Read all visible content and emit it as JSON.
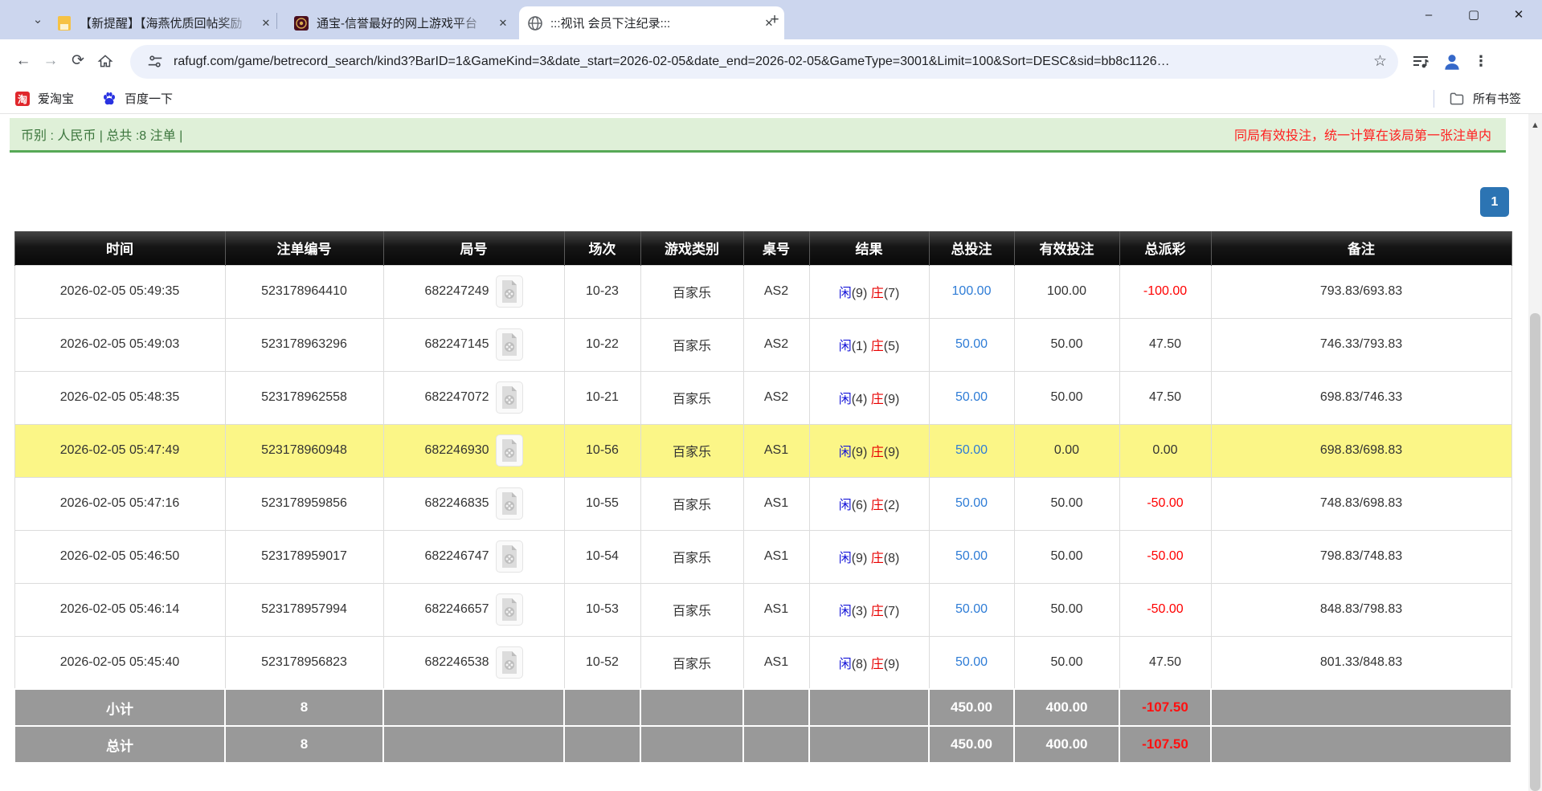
{
  "browser": {
    "tabs": [
      {
        "title": "【新提醒】【海燕优质回帖奖励",
        "favicon": "yellow-page-icon",
        "active": false
      },
      {
        "title": "通宝-信誉最好的网上游戏平台",
        "favicon": "tongbao-coin-icon",
        "active": false
      },
      {
        "title": ":::视讯 会员下注纪录:::",
        "favicon": "globe-icon",
        "active": true
      }
    ],
    "new_tab_label": "+",
    "window_controls": {
      "minimize": "–",
      "maximize": "▢",
      "close": "✕"
    },
    "url": "rafugf.com/game/betrecord_search/kind3?BarID=1&GameKind=3&date_start=2026-02-05&date_end=2026-02-05&GameType=3001&Limit=100&Sort=DESC&sid=bb8c1126…",
    "bookmarks": {
      "item1": "爱淘宝",
      "item2": "百度一下",
      "all_bookmarks": "所有书签"
    }
  },
  "page": {
    "info_bar": {
      "left": "币别 : 人民币 | 总共 :8 注单 |",
      "right": "同局有效投注，统一计算在该局第一张注单内"
    },
    "pagination": {
      "current": "1"
    },
    "table": {
      "headers": [
        "时间",
        "注单编号",
        "局号",
        "场次",
        "游戏类别",
        "桌号",
        "结果",
        "总投注",
        "有效投注",
        "总派彩",
        "备注"
      ],
      "rows": [
        {
          "time": "2026-02-05 05:49:35",
          "bet_id": "523178964410",
          "round": "682247249",
          "session": "10-23",
          "game": "百家乐",
          "table": "AS2",
          "player": "闲",
          "player_n": "(9)",
          "banker": "庄",
          "banker_n": "(7)",
          "total_bet": "100.00",
          "valid_bet": "100.00",
          "payout": "-100.00",
          "note": "793.83/693.83",
          "highlighted": false
        },
        {
          "time": "2026-02-05 05:49:03",
          "bet_id": "523178963296",
          "round": "682247145",
          "session": "10-22",
          "game": "百家乐",
          "table": "AS2",
          "player": "闲",
          "player_n": "(1)",
          "banker": "庄",
          "banker_n": "(5)",
          "total_bet": "50.00",
          "valid_bet": "50.00",
          "payout": "47.50",
          "note": "746.33/793.83",
          "highlighted": false
        },
        {
          "time": "2026-02-05 05:48:35",
          "bet_id": "523178962558",
          "round": "682247072",
          "session": "10-21",
          "game": "百家乐",
          "table": "AS2",
          "player": "闲",
          "player_n": "(4)",
          "banker": "庄",
          "banker_n": "(9)",
          "total_bet": "50.00",
          "valid_bet": "50.00",
          "payout": "47.50",
          "note": "698.83/746.33",
          "highlighted": false
        },
        {
          "time": "2026-02-05 05:47:49",
          "bet_id": "523178960948",
          "round": "682246930",
          "session": "10-56",
          "game": "百家乐",
          "table": "AS1",
          "player": "闲",
          "player_n": "(9)",
          "banker": "庄",
          "banker_n": "(9)",
          "total_bet": "50.00",
          "valid_bet": "0.00",
          "payout": "0.00",
          "note": "698.83/698.83",
          "highlighted": true
        },
        {
          "time": "2026-02-05 05:47:16",
          "bet_id": "523178959856",
          "round": "682246835",
          "session": "10-55",
          "game": "百家乐",
          "table": "AS1",
          "player": "闲",
          "player_n": "(6)",
          "banker": "庄",
          "banker_n": "(2)",
          "total_bet": "50.00",
          "valid_bet": "50.00",
          "payout": "-50.00",
          "note": "748.83/698.83",
          "highlighted": false
        },
        {
          "time": "2026-02-05 05:46:50",
          "bet_id": "523178959017",
          "round": "682246747",
          "session": "10-54",
          "game": "百家乐",
          "table": "AS1",
          "player": "闲",
          "player_n": "(9)",
          "banker": "庄",
          "banker_n": "(8)",
          "total_bet": "50.00",
          "valid_bet": "50.00",
          "payout": "-50.00",
          "note": "798.83/748.83",
          "highlighted": false
        },
        {
          "time": "2026-02-05 05:46:14",
          "bet_id": "523178957994",
          "round": "682246657",
          "session": "10-53",
          "game": "百家乐",
          "table": "AS1",
          "player": "闲",
          "player_n": "(3)",
          "banker": "庄",
          "banker_n": "(7)",
          "total_bet": "50.00",
          "valid_bet": "50.00",
          "payout": "-50.00",
          "note": "848.83/798.83",
          "highlighted": false
        },
        {
          "time": "2026-02-05 05:45:40",
          "bet_id": "523178956823",
          "round": "682246538",
          "session": "10-52",
          "game": "百家乐",
          "table": "AS1",
          "player": "闲",
          "player_n": "(8)",
          "banker": "庄",
          "banker_n": "(9)",
          "total_bet": "50.00",
          "valid_bet": "50.00",
          "payout": "47.50",
          "note": "801.33/848.83",
          "highlighted": false
        }
      ],
      "subtotal": {
        "label": "小计",
        "count": "8",
        "total_bet": "450.00",
        "valid_bet": "400.00",
        "payout": "-107.50"
      },
      "total": {
        "label": "总计",
        "count": "8",
        "total_bet": "450.00",
        "valid_bet": "400.00",
        "payout": "-107.50"
      }
    }
  },
  "colors": {
    "accent_blue": "#2e7cd6",
    "negative_red": "#ff0000",
    "player_blue": "#1414d8",
    "banker_red": "#e80000",
    "highlight_yellow": "#fbf687",
    "success_green_bg": "#dff0d8",
    "success_green_text": "#3c763d",
    "summary_gray": "#999999",
    "pager_blue": "#2c74b3"
  }
}
